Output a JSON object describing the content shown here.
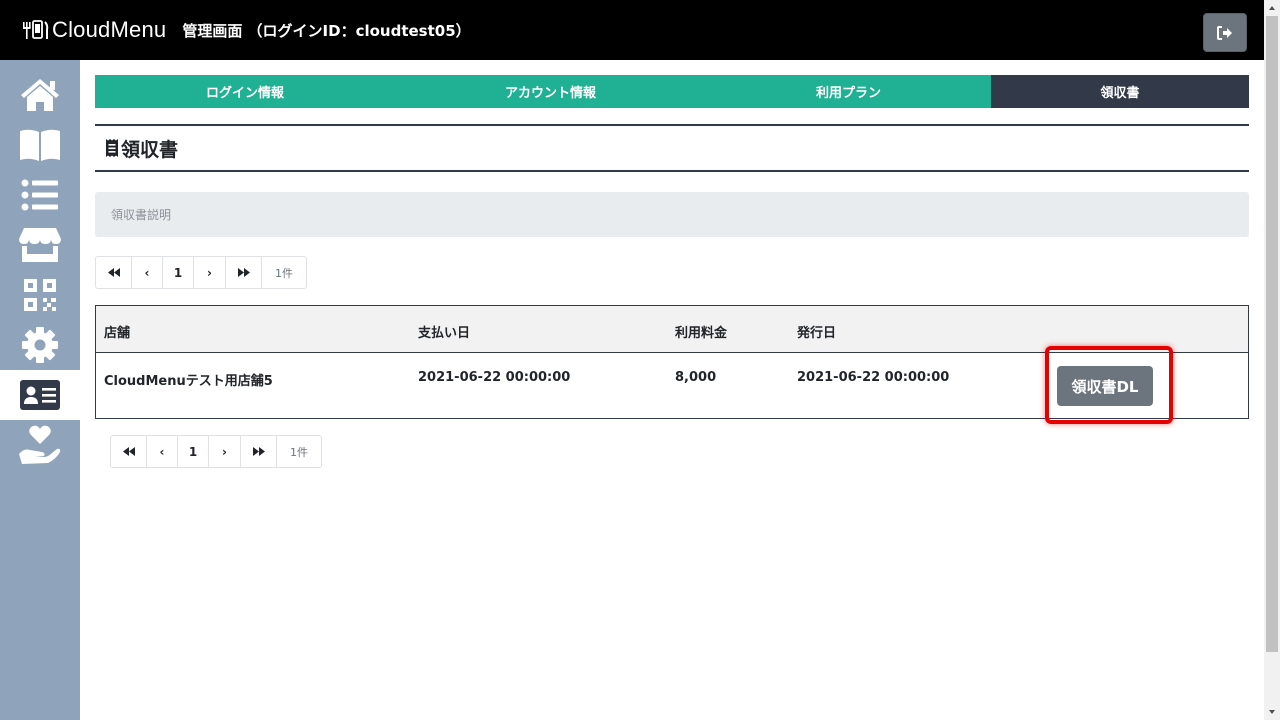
{
  "header": {
    "logo_text": "CloudMenu",
    "title": "管理画面 （ログインID：cloudtest05）"
  },
  "sidebar": {
    "items": [
      {
        "icon": "home-icon"
      },
      {
        "icon": "book-open-icon"
      },
      {
        "icon": "list-icon"
      },
      {
        "icon": "store-icon"
      },
      {
        "icon": "qrcode-icon"
      },
      {
        "icon": "gear-icon"
      },
      {
        "icon": "id-card-icon",
        "active": true
      },
      {
        "icon": "hand-holding-heart-icon"
      }
    ]
  },
  "tabs": [
    {
      "label": "ログイン情報"
    },
    {
      "label": "アカウント情報"
    },
    {
      "label": "利用プラン"
    },
    {
      "label": "領収書",
      "active": true
    }
  ],
  "section": {
    "title": "領収書",
    "description": "領収書説明"
  },
  "pager": {
    "first": "⏪",
    "prev": "‹",
    "page": "1",
    "next": "›",
    "last": "⏩",
    "count": "1件"
  },
  "table": {
    "headers": [
      "店舗",
      "支払い日",
      "利用料金",
      "発行日"
    ],
    "rows": [
      {
        "store": "CloudMenuテスト用店舗5",
        "payment_date": "2021-06-22 00:00:00",
        "fee": "8,000",
        "issue_date": "2021-06-22 00:00:00",
        "button": "領収書DL"
      }
    ]
  },
  "colors": {
    "header_bg": "#000000",
    "sidebar_bg": "#8fa3ba",
    "tab_bg": "#20b093",
    "tab_active_bg": "#323a4a",
    "highlight": "#e60000",
    "button_bg": "#6c757d"
  }
}
